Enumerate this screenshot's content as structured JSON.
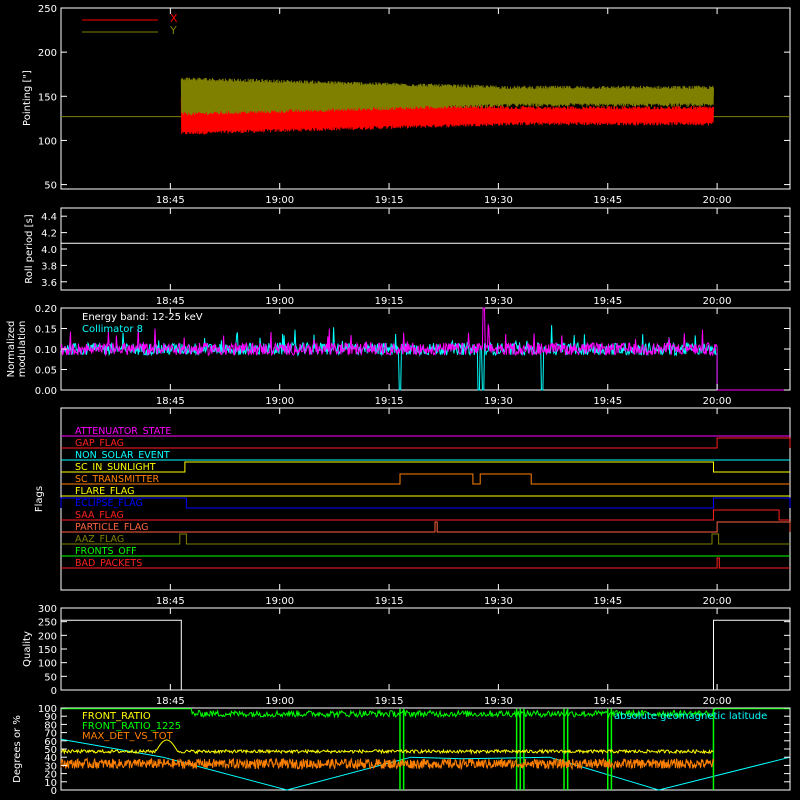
{
  "colors": {
    "background": "#000000",
    "axis": "#ffffff",
    "x_series": "#ff0000",
    "y_series": "#808000",
    "cyan": "#00ffff",
    "magenta": "#ff00ff",
    "green": "#00ff00",
    "yellow": "#ffff00",
    "orange": "#ff8000"
  },
  "time_axis": {
    "range_min": [
      1830,
      1930
    ],
    "tick_labels": [
      "18:45",
      "19:00",
      "19:15",
      "19:30",
      "19:45",
      "20:00"
    ],
    "tick_minutes": [
      1845,
      1860,
      1875,
      1890,
      1905,
      1920
    ]
  },
  "chart_data": [
    {
      "id": "pointing",
      "type": "line",
      "ylabel": "Pointing [\"]",
      "ylim": [
        45,
        250
      ],
      "yticks": [
        50,
        100,
        150,
        200,
        250
      ],
      "legend": [
        {
          "name": "X",
          "color": "#ff0000"
        },
        {
          "name": "Y",
          "color": "#808000"
        }
      ],
      "baseline_value": 127,
      "series": [
        {
          "name": "X",
          "center": 128,
          "amplitude_start": 40,
          "amplitude_end": 18,
          "start_min": 1846.5,
          "end_min": 1919.5
        },
        {
          "name": "Y",
          "center": 150,
          "amplitude_start": 40,
          "amplitude_end": 20,
          "start_min": 1846.5,
          "end_min": 1919.5
        }
      ]
    },
    {
      "id": "roll",
      "type": "line",
      "ylabel": "Roll period [s]",
      "ylim": [
        3.5,
        4.5
      ],
      "yticks": [
        3.6,
        3.8,
        4.0,
        4.2,
        4.4
      ],
      "value": 4.07
    },
    {
      "id": "modulation",
      "type": "line",
      "ylabel_lines": [
        "Normalized",
        "modulation"
      ],
      "ylim": [
        0,
        0.2
      ],
      "yticks": [
        0.0,
        0.05,
        0.1,
        0.15,
        0.2
      ],
      "annotation": "Energy band: 12-25 keV",
      "series": [
        {
          "name": "Collimator 8",
          "color": "#00ffff",
          "level": 0.1
        },
        {
          "name": "magenta",
          "color": "#ff00ff",
          "level": 0.1
        }
      ],
      "end_min": 1920
    },
    {
      "id": "flags",
      "type": "line",
      "ylabel": "Flags",
      "flags": [
        {
          "name": "ATTENUATOR_STATE",
          "color": "#ff00ff",
          "on": []
        },
        {
          "name": "GAP_FLAG",
          "color": "#ff2020",
          "on": [
            [
              1920,
              1930
            ]
          ]
        },
        {
          "name": "NON_SOLAR_EVENT",
          "color": "#00ffff",
          "on": []
        },
        {
          "name": "SC_IN_SUNLIGHT",
          "color": "#ffff00",
          "on": [
            [
              1847,
              1919.5
            ]
          ]
        },
        {
          "name": "SC_TRANSMITTER",
          "color": "#ff8000",
          "on": [
            [
              1876.5,
              1886.5
            ],
            [
              1887.5,
              1894.5
            ]
          ]
        },
        {
          "name": "FLARE_FLAG",
          "color": "#ffff00",
          "on": []
        },
        {
          "name": "ECLIPSE_FLAG",
          "color": "#0000ff",
          "on": [
            [
              1830,
              1847.2
            ],
            [
              1919.5,
              1930
            ]
          ]
        },
        {
          "name": "SAA_FLAG",
          "color": "#ff2020",
          "on": [
            [
              1919.5,
              1928.5
            ]
          ]
        },
        {
          "name": "PARTICLE_FLAG",
          "color": "#ff6040",
          "on": [
            [
              1881.3,
              1881.6
            ],
            [
              1920,
              1930
            ]
          ]
        },
        {
          "name": "AAZ_FLAG",
          "color": "#808000",
          "on": [
            [
              1846.3,
              1847.2
            ],
            [
              1919.3,
              1920.2
            ]
          ]
        },
        {
          "name": "FRONTS_OFF",
          "color": "#00ff00",
          "on": []
        },
        {
          "name": "BAD_PACKETS",
          "color": "#ff2020",
          "on": [
            [
              1920,
              1920.3
            ]
          ]
        }
      ]
    },
    {
      "id": "quality",
      "type": "line",
      "ylabel": "Quality",
      "ylim": [
        0,
        300
      ],
      "yticks": [
        0,
        50,
        100,
        150,
        200,
        250,
        300
      ],
      "segments": [
        {
          "from": 1830,
          "to": 1846.5,
          "value": 255
        },
        {
          "from": 1846.5,
          "to": 1919.5,
          "value": 0
        },
        {
          "from": 1919.5,
          "to": 1930,
          "value": 255
        }
      ]
    },
    {
      "id": "ratios",
      "type": "line",
      "ylabel": "Degrees or %",
      "ylim": [
        0,
        100
      ],
      "yticks": [
        0,
        10,
        20,
        30,
        40,
        50,
        60,
        70,
        80,
        90,
        100
      ],
      "legend": [
        {
          "name": "FRONT_RATIO",
          "color": "#ffff00"
        },
        {
          "name": "FRONT_RATIO_1225",
          "color": "#00ff00"
        },
        {
          "name": "MAX_DET_VS_TOT",
          "color": "#ff8000"
        }
      ],
      "annotation": "absolute geomagnetic latitude",
      "latitude_points": [
        [
          1830,
          62
        ],
        [
          1844,
          40
        ],
        [
          1861,
          0
        ],
        [
          1878,
          40
        ],
        [
          1885,
          38
        ],
        [
          1897,
          40
        ],
        [
          1912,
          0
        ],
        [
          1930,
          40
        ]
      ]
    }
  ]
}
